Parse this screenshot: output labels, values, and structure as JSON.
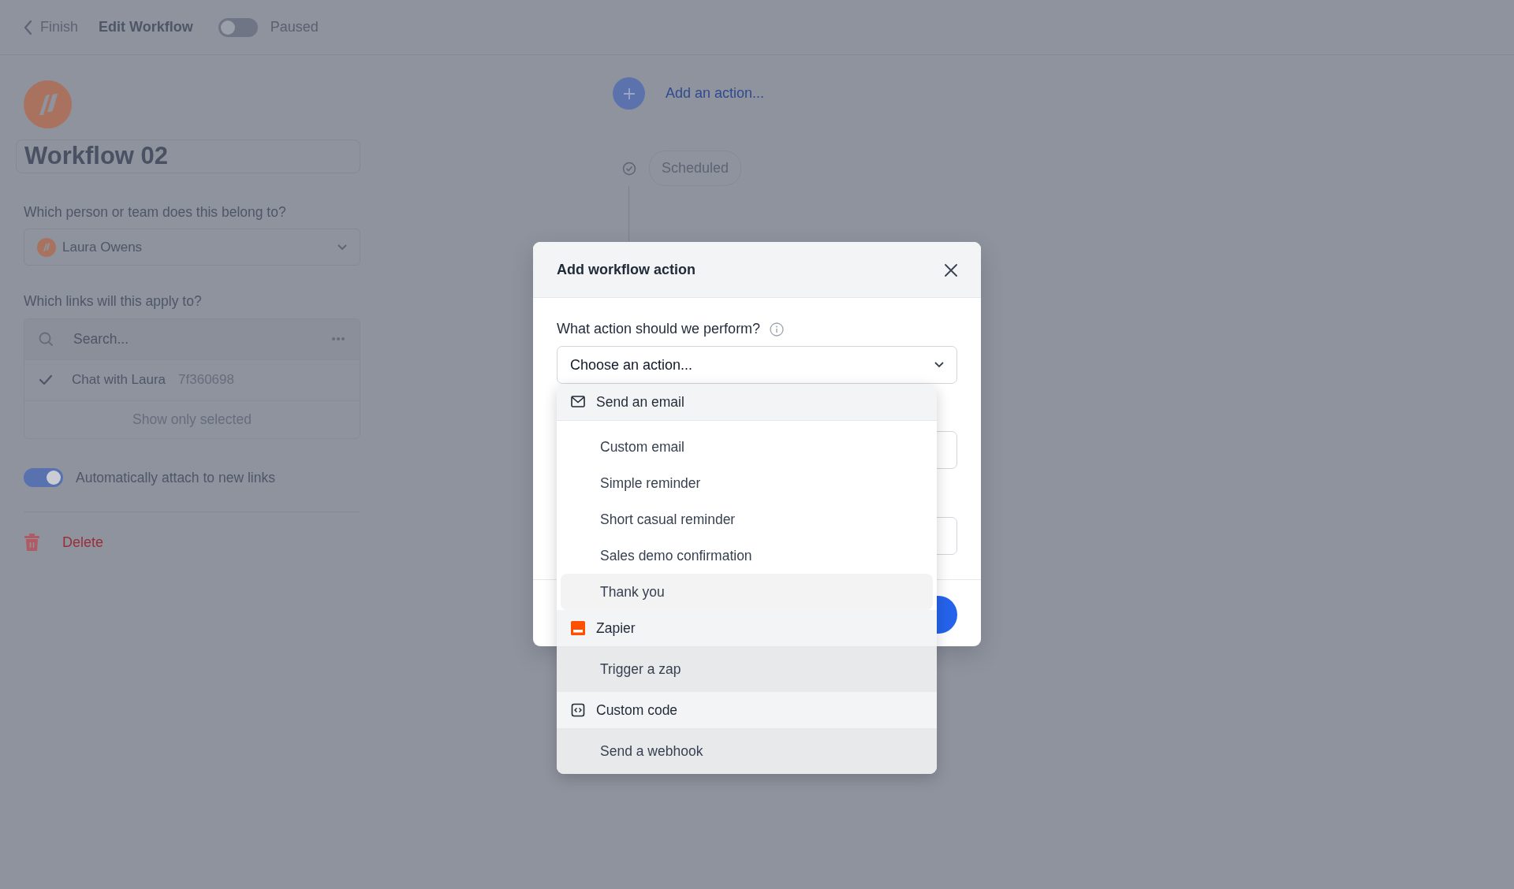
{
  "topbar": {
    "back": "Finish",
    "title": "Edit Workflow",
    "paused_toggle": {
      "on": false
    },
    "status": "Paused"
  },
  "sidebar": {
    "name": "Workflow 02",
    "owner_label": "Which person or team does this belong to?",
    "owner": "Laura Owens",
    "links_label": "Which links will this apply to?",
    "search": {
      "placeholder": "Search..."
    },
    "links": [
      {
        "name": "Chat with Laura",
        "code": "7f360698",
        "checked": true
      }
    ],
    "show_only": "Show only selected",
    "auto_attach": {
      "label": "Automatically attach to new links",
      "on": true
    },
    "delete": "Delete"
  },
  "canvas": {
    "add_action": "Add an action...",
    "trigger": "Scheduled"
  },
  "modal": {
    "title": "Add workflow action",
    "question": "What action should we perform?",
    "select": {
      "placeholder": "Choose an action..."
    },
    "options": [
      {
        "kind": "group",
        "label": "Send an email"
      },
      {
        "kind": "item",
        "label": "Custom email",
        "highlighted": false,
        "dimmed": false
      },
      {
        "kind": "item",
        "label": "Simple reminder",
        "highlighted": false,
        "dimmed": false
      },
      {
        "kind": "item",
        "label": "Short casual reminder",
        "highlighted": false,
        "dimmed": false
      },
      {
        "kind": "item",
        "label": "Sales demo confirmation",
        "highlighted": false,
        "dimmed": false
      },
      {
        "kind": "item",
        "label": "Thank you",
        "highlighted": true,
        "dimmed": false
      },
      {
        "kind": "group",
        "label": "Zapier"
      },
      {
        "kind": "item",
        "label": "Trigger a zap",
        "highlighted": false,
        "dimmed": true
      },
      {
        "kind": "group",
        "label": "Custom code"
      },
      {
        "kind": "item",
        "label": "Send a webhook",
        "highlighted": false,
        "dimmed": true
      }
    ]
  }
}
